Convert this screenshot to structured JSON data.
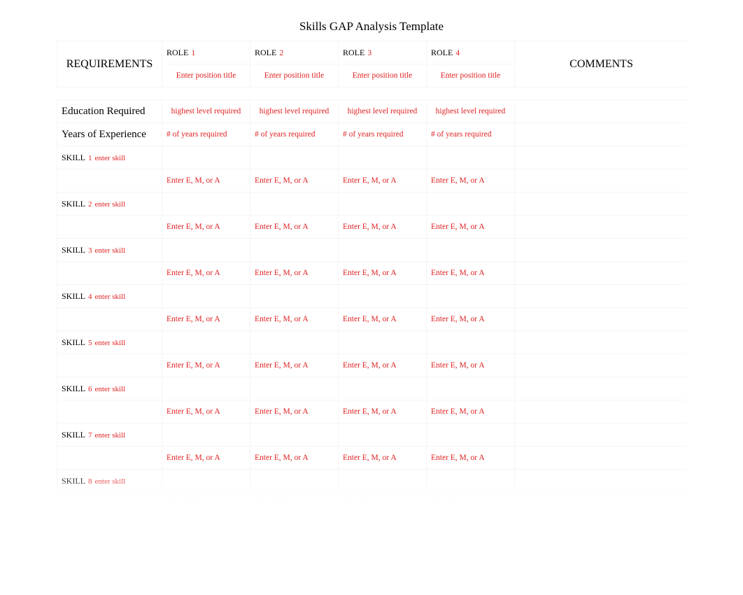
{
  "title": "Skills GAP Analysis Template",
  "headers": {
    "requirements": "REQUIREMENTS",
    "comments": "COMMENTS",
    "role_label": "ROLE",
    "role_placeholder": "Enter position title"
  },
  "row_education": "Education Required",
  "row_experience": "Years of Experience",
  "ph_highest": "highest level required",
  "ph_years": "# of years required",
  "skill_label": "SKILL",
  "skill_placeholder": "enter skill",
  "ph_ema": "Enter E, M, or A",
  "role_count": 4,
  "skill_rows": 8
}
